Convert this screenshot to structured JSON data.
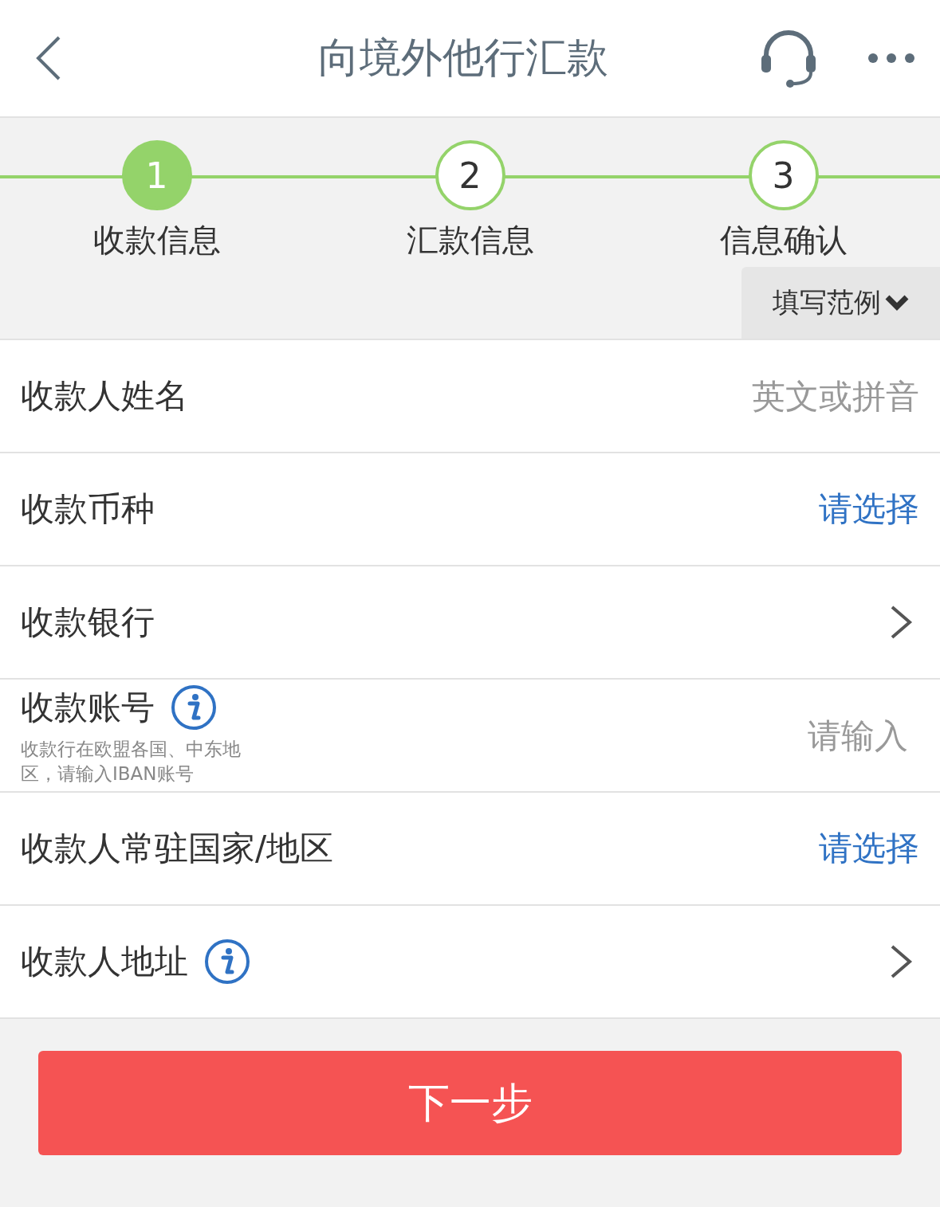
{
  "header": {
    "title": "向境外他行汇款"
  },
  "steps": [
    {
      "number": "1",
      "label": "收款信息",
      "selected": true
    },
    {
      "number": "2",
      "label": "汇款信息",
      "selected": false
    },
    {
      "number": "3",
      "label": "信息确认",
      "selected": false
    }
  ],
  "example_button": {
    "label": "填写范例"
  },
  "rows": [
    {
      "kind": "input",
      "label": "收款人姓名",
      "info": false,
      "placeholder": "英文或拼音"
    },
    {
      "kind": "select",
      "label": "收款币种",
      "info": false,
      "value": "请选择"
    },
    {
      "kind": "nav",
      "label": "收款银行",
      "info": false
    },
    {
      "kind": "input",
      "label": "收款账号",
      "info": true,
      "hint": "收款行在欧盟各国、中东地区，请输入IBAN账号",
      "placeholder": "请输入"
    },
    {
      "kind": "select",
      "label": "收款人常驻国家/地区",
      "info": false,
      "value": "请选择"
    },
    {
      "kind": "nav",
      "label": "收款人地址",
      "info": true
    }
  ],
  "next_button": {
    "label": "下一步"
  }
}
